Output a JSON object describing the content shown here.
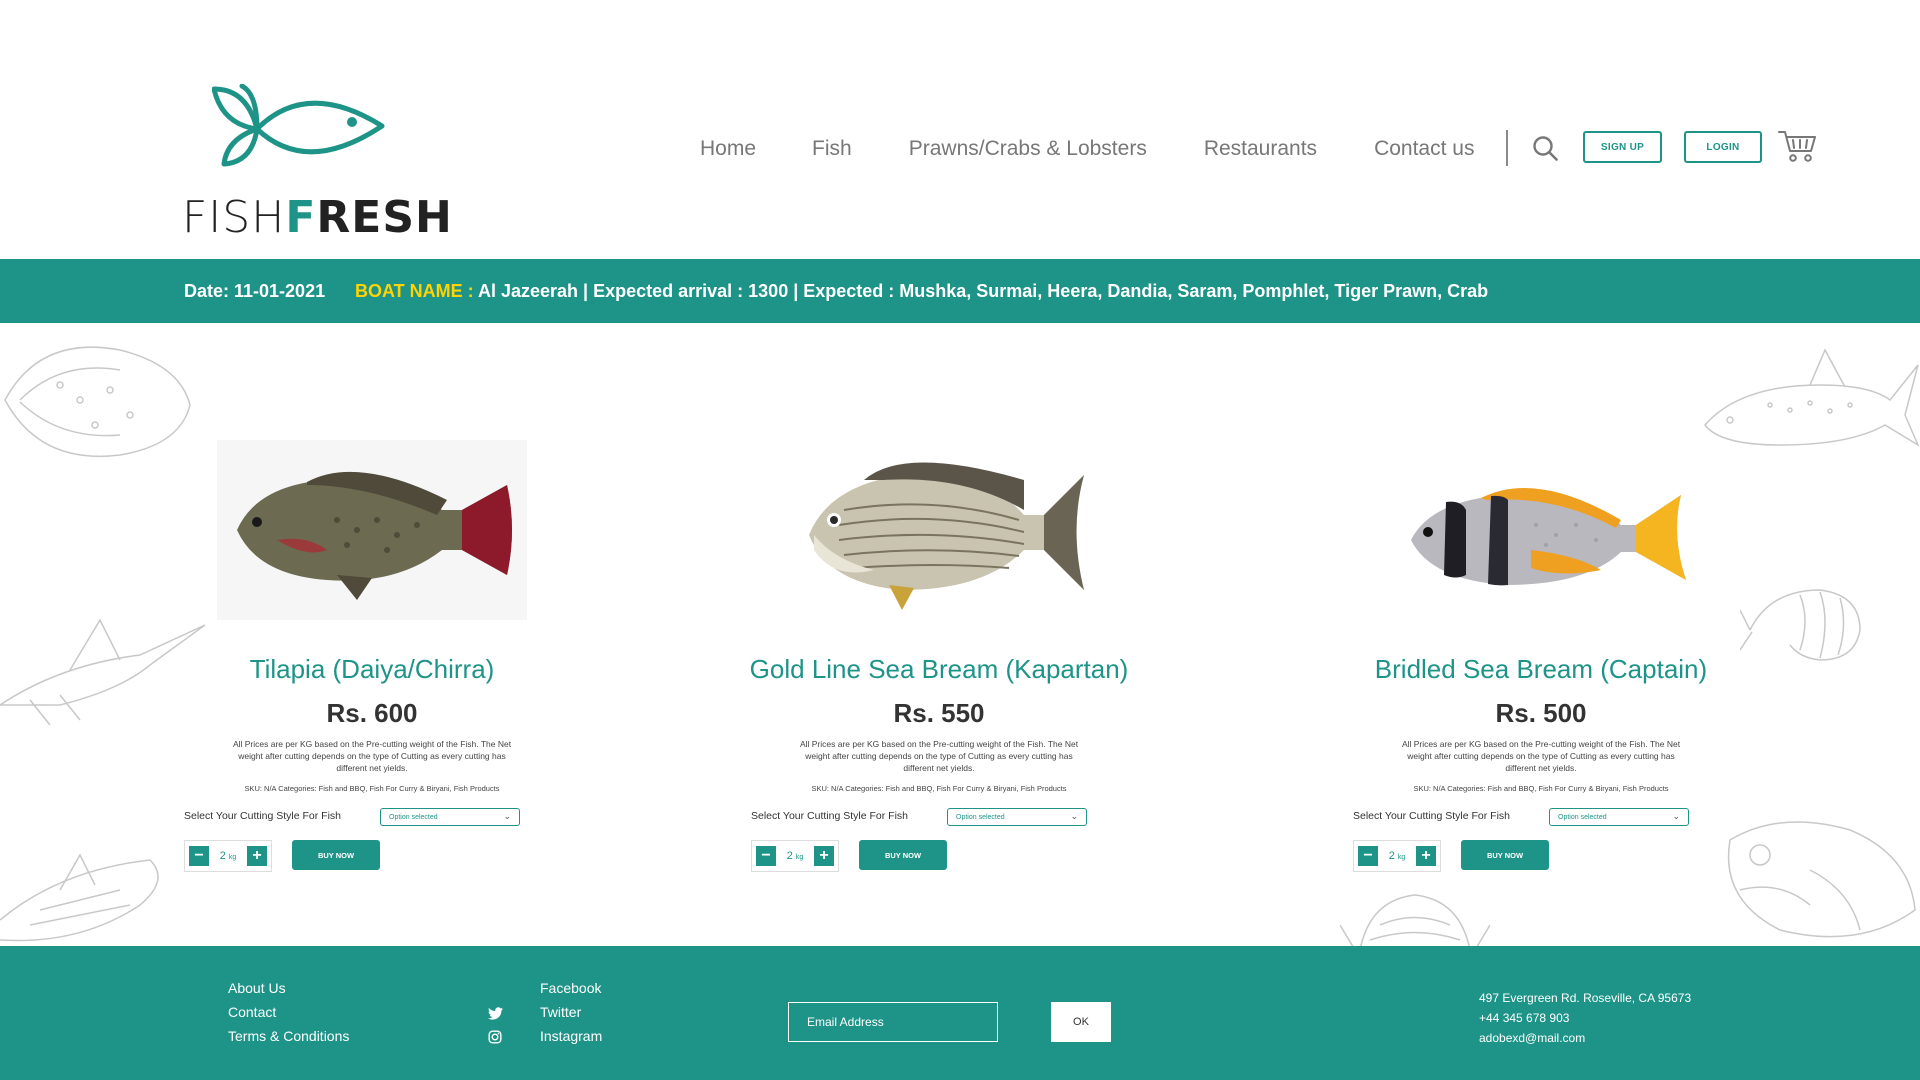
{
  "brand": {
    "name_part1": "FISH",
    "name_part2_first": "F",
    "name_part2_rest": "RESH",
    "accent": "#1e9488"
  },
  "nav": {
    "items": [
      "Home",
      "Fish",
      "Prawns/Crabs & Lobsters",
      "Restaurants",
      "Contact us"
    ],
    "signup_label": "SIGN UP",
    "login_label": "LOGIN",
    "search_icon": "search-icon",
    "cart_icon": "cart-icon"
  },
  "banner": {
    "date": "Date: 11-01-2021",
    "boat_label": "BOAT NAME :",
    "boat_info": " Al Jazeerah | Expected arrival : 1300 | Expected : Mushka, Surmai, Heera, Dandia, Saram, Pomphlet, Tiger Prawn, Crab",
    "label_color": "#ffd400"
  },
  "products": [
    {
      "name": "Tilapia (Daiya/Chirra)",
      "price": "Rs. 600",
      "note": "All Prices are per KG based on the Pre-cutting weight of the Fish. The Net weight after cutting depends on the type of Cutting as every cutting has different net yields.",
      "sku": "SKU: N/A Categories: Fish and BBQ, Fish For Curry & Biryani, Fish Products",
      "cut_label": "Select Your Cutting Style For Fish",
      "select_value": "Option selected",
      "qty": "2",
      "qty_unit": "kg",
      "buy_label": "BUY NOW"
    },
    {
      "name": "Gold Line Sea Bream (Kapartan)",
      "price": "Rs. 550",
      "note": "All Prices are per KG based on the Pre-cutting weight of the Fish. The Net weight after cutting depends on the type of Cutting as every cutting has different net yields.",
      "sku": "SKU: N/A Categories: Fish and BBQ, Fish For Curry & Biryani, Fish Products",
      "cut_label": "Select Your Cutting Style For Fish",
      "select_value": "Option selected",
      "qty": "2",
      "qty_unit": "kg",
      "buy_label": "BUY NOW"
    },
    {
      "name": "Bridled Sea Bream (Captain)",
      "price": "Rs. 500",
      "note": "All Prices are per KG based on the Pre-cutting weight of the Fish. The Net weight after cutting depends on the type of Cutting as every cutting has different net yields.",
      "sku": "SKU: N/A Categories: Fish and BBQ, Fish For Curry & Biryani, Fish Products",
      "cut_label": "Select Your Cutting Style For Fish",
      "select_value": "Option selected",
      "qty": "2",
      "qty_unit": "kg",
      "buy_label": "BUY NOW"
    }
  ],
  "footer": {
    "links": [
      "About Us",
      "Contact",
      "Terms & Conditions"
    ],
    "social": [
      "Facebook",
      "Twitter",
      "Instagram"
    ],
    "email_placeholder": "Email Address",
    "ok_label": "OK",
    "address": "497 Evergreen Rd. Roseville, CA 95673",
    "phone": "+44 345 678 903",
    "email": "adobexd@mail.com"
  }
}
